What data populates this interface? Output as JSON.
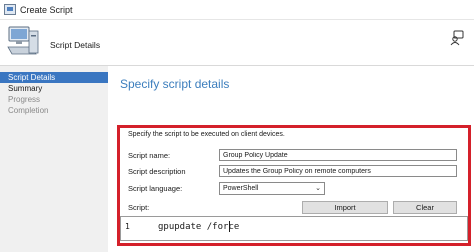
{
  "window": {
    "title": "Create Script"
  },
  "header": {
    "title": "Script Details",
    "icon": "computer-wizard-icon",
    "help_icon": "user-help-icon"
  },
  "sidebar": {
    "items": [
      {
        "label": "Script Details",
        "state": "active"
      },
      {
        "label": "Summary",
        "state": "enabled"
      },
      {
        "label": "Progress",
        "state": "disabled"
      },
      {
        "label": "Completion",
        "state": "disabled"
      }
    ]
  },
  "main": {
    "heading": "Specify script details",
    "instruction": "Specify the script to be executed on client devices.",
    "fields": {
      "script_name": {
        "label": "Script name:",
        "value": "Group Policy Update"
      },
      "script_description": {
        "label": "Script description",
        "value": "Updates the Group Policy on remote computers"
      },
      "script_language": {
        "label": "Script language:",
        "value": "PowerShell"
      }
    },
    "script": {
      "label": "Script:",
      "import_label": "Import",
      "clear_label": "Clear",
      "line_number": "1",
      "code": "gpupdate /force"
    }
  },
  "colors": {
    "accent": "#3a76c1",
    "heading": "#3c7ebd",
    "highlight_box": "#d4202a"
  }
}
